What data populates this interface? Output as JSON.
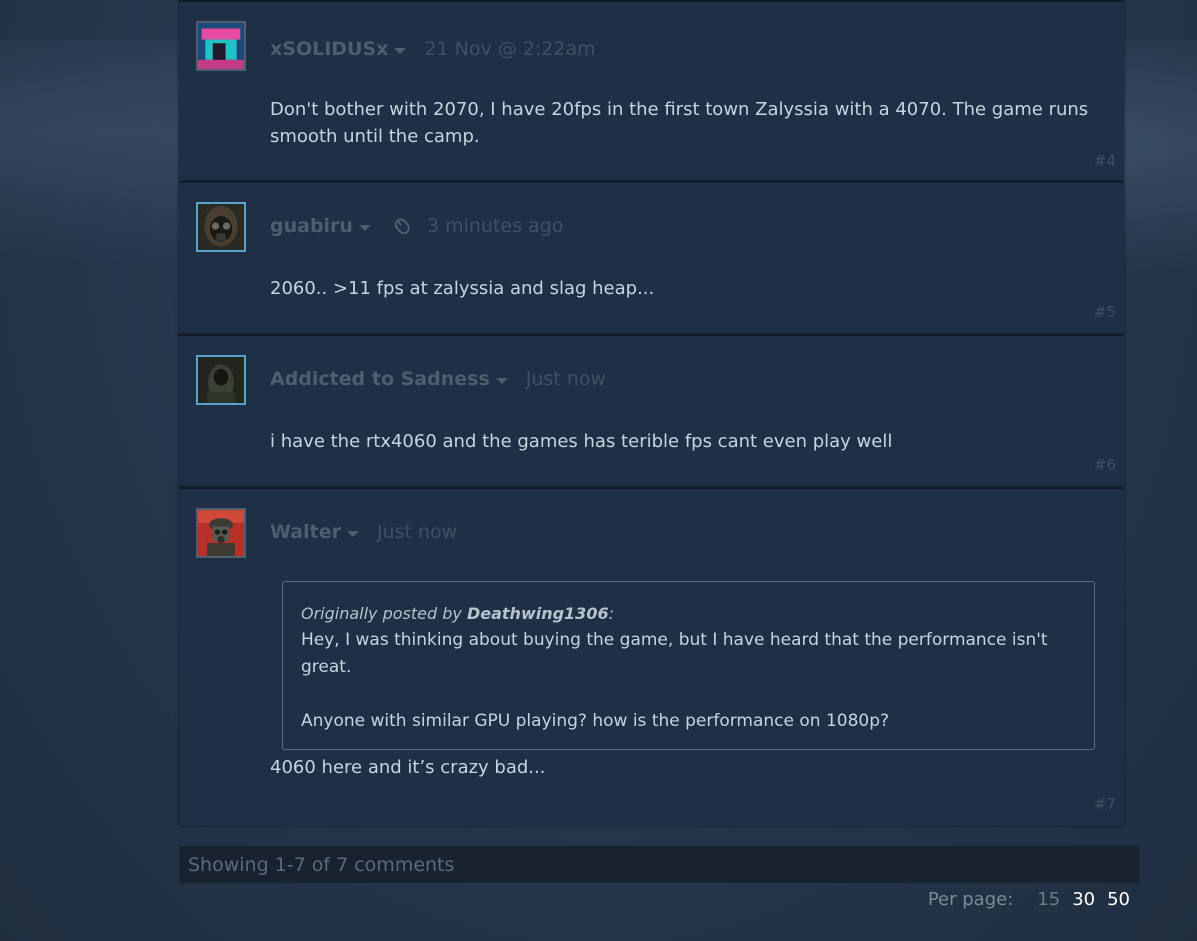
{
  "comments": [
    {
      "author": "xSOLIDUSx",
      "timestamp": "21 Nov @ 2:22am",
      "text": "Don't bother with 2070, I have 20fps in the first town Zalyssia with a 4070. The game runs smooth until the camp.",
      "number": "#4"
    },
    {
      "author": "guabiru",
      "timestamp": "3 minutes ago",
      "text": "2060.. >11 fps at zalyssia and slag heap...",
      "number": "#5"
    },
    {
      "author": "Addicted to Sadness",
      "timestamp": "Just now",
      "text": "i have the rtx4060 and the games has terible fps cant even play well",
      "number": "#6"
    },
    {
      "author": "Walter",
      "timestamp": "Just now",
      "quote": {
        "prefix": "Originally posted by ",
        "author": "Deathwing1306",
        "suffix": ":",
        "line1": "Hey, I was thinking about buying the game, but I have heard that the performance isn't great.",
        "line2": "Anyone with similar GPU playing? how is the performance on 1080p?"
      },
      "text": "4060 here and it’s crazy bad...",
      "number": "#7"
    }
  ],
  "footer": {
    "showing": "Showing 1-7 of 7 comments",
    "per_page_label": "Per page:",
    "per_page_options": [
      "15",
      "30",
      "50"
    ]
  },
  "icons": {
    "author_menu": "caret-down-icon",
    "device": "mouse-icon"
  },
  "colors": {
    "panel_bg": "#1f2f45",
    "author": "#4d5e6c",
    "text": "#c6d4df",
    "avatar_border_online": "#57a4c7"
  }
}
